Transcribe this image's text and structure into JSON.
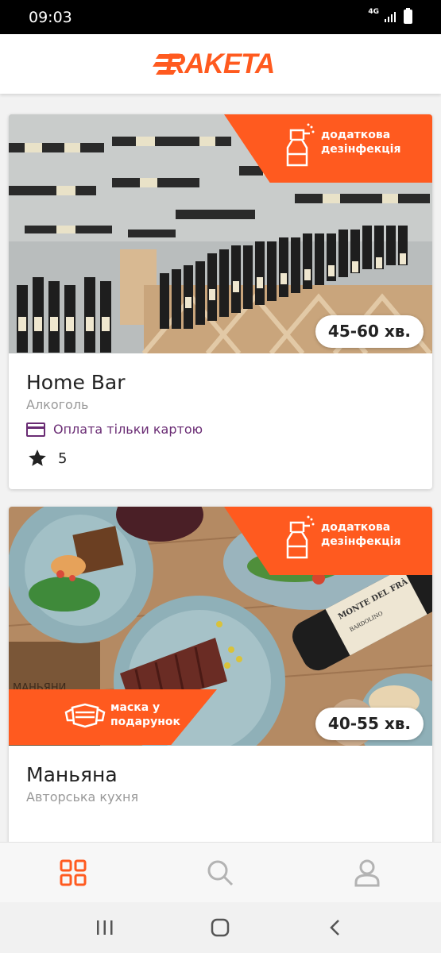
{
  "status_bar": {
    "time": "09:03",
    "network": "4G"
  },
  "header": {
    "logo_text": "RAKETA",
    "brand_color": "#ff5a1f"
  },
  "restaurants": [
    {
      "name": "Home Bar",
      "category": "Алкоголь",
      "payment_note": "Оплата тільки картою",
      "rating": "5",
      "eta": "45-60 хв.",
      "promo_top": "додаткова дезінфекція"
    },
    {
      "name": "Маньяна",
      "category": "Авторська кухня",
      "eta": "40-55 хв.",
      "promo_top": "додаткова дезінфекція",
      "promo_bottom": "маска у подарунок",
      "image_text": {
        "sign": "МАНЬЯНИ",
        "bottle_label": "MONTE DEL FRÀ",
        "bottle_sub": "BARDOLINO"
      }
    }
  ],
  "bottom_nav": {
    "items": [
      "grid-icon",
      "search-icon",
      "profile-icon"
    ],
    "active_color": "#ff5a1f",
    "inactive_color": "#b3b3b3"
  },
  "system_nav": {
    "items": [
      "recents-icon",
      "home-icon",
      "back-icon"
    ]
  }
}
